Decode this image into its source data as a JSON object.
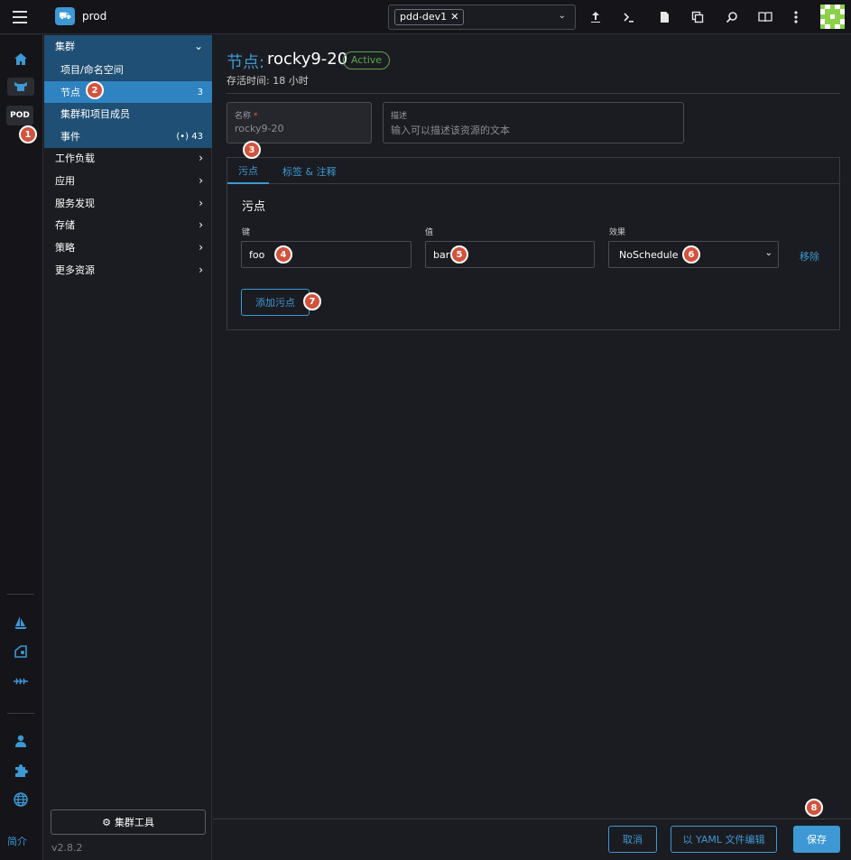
{
  "topbar": {
    "cluster_name": "prod",
    "namespace_chip": "pdd-dev1",
    "namespace_remove_icon": "✕",
    "dropdown_icon": "⌄",
    "icons": [
      "upload-icon",
      "terminal-icon",
      "file-icon",
      "copy-icon",
      "search-icon",
      "book-icon",
      "more-icon"
    ]
  },
  "rail": {
    "pod_label": "POD",
    "about_label": "简介"
  },
  "sidenav": {
    "cluster_group": "集群",
    "items": [
      {
        "label": "项目/命名空间",
        "count": ""
      },
      {
        "label": "节点",
        "count": "3"
      },
      {
        "label": "集群和项目成员",
        "count": ""
      },
      {
        "label": "事件",
        "count": "43"
      }
    ],
    "sections": [
      "工作负载",
      "应用",
      "服务发现",
      "存储",
      "策略",
      "更多资源"
    ],
    "cluster_tools_label": "集群工具",
    "version": "v2.8.2"
  },
  "header": {
    "kind": "节点:",
    "name": "rocky9-20",
    "state": "Active",
    "age": "存活时间: 18 小时"
  },
  "form": {
    "name_label": "名称",
    "name_required": "*",
    "name_value": "rocky9-20",
    "desc_label": "描述",
    "desc_placeholder": "输入可以描述该资源的文本"
  },
  "tabs": [
    "污点",
    "标签 & 注释"
  ],
  "taints": {
    "section_title": "污点",
    "key_label": "键",
    "value_label": "值",
    "effect_label": "效果",
    "key_value": "foo",
    "value_value": "bar",
    "effect_value": "NoSchedule",
    "remove_label": "移除",
    "add_label": "添加污点"
  },
  "footer": {
    "cancel": "取消",
    "edit_yaml": "以 YAML 文件编辑",
    "save": "保存"
  },
  "markers": [
    "1",
    "2",
    "3",
    "4",
    "5",
    "6",
    "7",
    "8"
  ],
  "colors": {
    "accent": "#3d98d3",
    "marker": "#d2533d",
    "active_state": "#5fa34f"
  }
}
